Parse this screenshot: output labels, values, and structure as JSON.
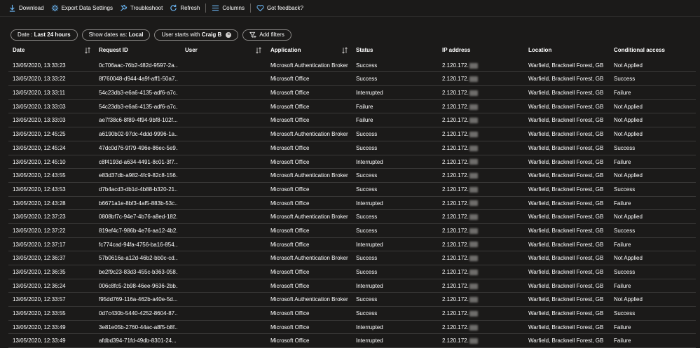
{
  "toolbar": {
    "download": "Download",
    "export": "Export Data Settings",
    "troubleshoot": "Troubleshoot",
    "refresh": "Refresh",
    "columns": "Columns",
    "feedback": "Got feedback?"
  },
  "filters": {
    "date_label": "Date : ",
    "date_value": "Last 24 hours",
    "showdates_label": "Show dates as: ",
    "showdates_value": "Local",
    "user_label": "User starts with ",
    "user_value": "Craig B",
    "add_filters": "Add filters"
  },
  "columns": {
    "date": "Date",
    "request_id": "Request ID",
    "user": "User",
    "application": "Application",
    "status": "Status",
    "ip_address": "IP address",
    "location": "Location",
    "conditional_access": "Conditional access"
  },
  "rows": [
    {
      "date": "13/05/2020, 13:33:23",
      "request_id": "0c706aac-76b2-482d-9597-2a...",
      "application": "Microsoft Authentication Broker",
      "status": "Success",
      "ip": "2.120.172.",
      "location": "Warfield, Bracknell Forest, GB",
      "ca": "Not Applied"
    },
    {
      "date": "13/05/2020, 13:33:22",
      "request_id": "8f760048-d944-4a9f-aff1-50a7...",
      "application": "Microsoft Office",
      "status": "Success",
      "ip": "2.120.172.",
      "location": "Warfield, Bracknell Forest, GB",
      "ca": "Success"
    },
    {
      "date": "13/05/2020, 13:33:11",
      "request_id": "54c23db3-e6a6-4135-adf6-a7c...",
      "application": "Microsoft Office",
      "status": "Interrupted",
      "ip": "2.120.172.",
      "location": "Warfield, Bracknell Forest, GB",
      "ca": "Failure"
    },
    {
      "date": "13/05/2020, 13:33:03",
      "request_id": "54c23db3-e6a6-4135-adf6-a7c...",
      "application": "Microsoft Office",
      "status": "Failure",
      "ip": "2.120.172.",
      "location": "Warfield, Bracknell Forest, GB",
      "ca": "Not Applied"
    },
    {
      "date": "13/05/2020, 13:33:03",
      "request_id": "ae7f38c6-8f89-4f94-9bf8-102f...",
      "application": "Microsoft Office",
      "status": "Failure",
      "ip": "2.120.172.",
      "location": "Warfield, Bracknell Forest, GB",
      "ca": "Not Applied"
    },
    {
      "date": "13/05/2020, 12:45:25",
      "request_id": "a6190b02-97dc-4ddd-9996-1a...",
      "application": "Microsoft Authentication Broker",
      "status": "Success",
      "ip": "2.120.172.",
      "location": "Warfield, Bracknell Forest, GB",
      "ca": "Not Applied"
    },
    {
      "date": "13/05/2020, 12:45:24",
      "request_id": "47dc0d76-9f79-496e-86ec-5e9...",
      "application": "Microsoft Office",
      "status": "Success",
      "ip": "2.120.172.",
      "location": "Warfield, Bracknell Forest, GB",
      "ca": "Success"
    },
    {
      "date": "13/05/2020, 12:45:10",
      "request_id": "c8f4193d-a634-4491-8c01-3f7...",
      "application": "Microsoft Office",
      "status": "Interrupted",
      "ip": "2.120.172.",
      "location": "Warfield, Bracknell Forest, GB",
      "ca": "Failure"
    },
    {
      "date": "13/05/2020, 12:43:55",
      "request_id": "e83d37db-a982-4fc9-82c8-156...",
      "application": "Microsoft Authentication Broker",
      "status": "Success",
      "ip": "2.120.172.",
      "location": "Warfield, Bracknell Forest, GB",
      "ca": "Not Applied"
    },
    {
      "date": "13/05/2020, 12:43:53",
      "request_id": "d7b4acd3-db1d-4b88-b320-21...",
      "application": "Microsoft Office",
      "status": "Success",
      "ip": "2.120.172.",
      "location": "Warfield, Bracknell Forest, GB",
      "ca": "Success"
    },
    {
      "date": "13/05/2020, 12:43:28",
      "request_id": "b6671a1e-8bf3-4af5-883b-53c...",
      "application": "Microsoft Office",
      "status": "Interrupted",
      "ip": "2.120.172.",
      "location": "Warfield, Bracknell Forest, GB",
      "ca": "Failure"
    },
    {
      "date": "13/05/2020, 12:37:23",
      "request_id": "0808bf7c-94e7-4b76-a8ed-182...",
      "application": "Microsoft Authentication Broker",
      "status": "Success",
      "ip": "2.120.172.",
      "location": "Warfield, Bracknell Forest, GB",
      "ca": "Not Applied"
    },
    {
      "date": "13/05/2020, 12:37:22",
      "request_id": "819ef4c7-986b-4e76-aa12-4b2...",
      "application": "Microsoft Office",
      "status": "Success",
      "ip": "2.120.172.",
      "location": "Warfield, Bracknell Forest, GB",
      "ca": "Success"
    },
    {
      "date": "13/05/2020, 12:37:17",
      "request_id": "fc774cad-94fa-4756-ba16-854...",
      "application": "Microsoft Office",
      "status": "Interrupted",
      "ip": "2.120.172.",
      "location": "Warfield, Bracknell Forest, GB",
      "ca": "Failure"
    },
    {
      "date": "13/05/2020, 12:36:37",
      "request_id": "57b0616a-a12d-46b2-bb0c-cd...",
      "application": "Microsoft Authentication Broker",
      "status": "Success",
      "ip": "2.120.172.",
      "location": "Warfield, Bracknell Forest, GB",
      "ca": "Not Applied"
    },
    {
      "date": "13/05/2020, 12:36:35",
      "request_id": "be2f9c23-83d3-455c-b363-058...",
      "application": "Microsoft Office",
      "status": "Success",
      "ip": "2.120.172.",
      "location": "Warfield, Bracknell Forest, GB",
      "ca": "Success"
    },
    {
      "date": "13/05/2020, 12:36:24",
      "request_id": "006c8fc5-2b98-46ee-9636-2bb...",
      "application": "Microsoft Office",
      "status": "Interrupted",
      "ip": "2.120.172.",
      "location": "Warfield, Bracknell Forest, GB",
      "ca": "Failure"
    },
    {
      "date": "13/05/2020, 12:33:57",
      "request_id": "f95dd769-116a-462b-a40e-5d...",
      "application": "Microsoft Authentication Broker",
      "status": "Success",
      "ip": "2.120.172.",
      "location": "Warfield, Bracknell Forest, GB",
      "ca": "Not Applied"
    },
    {
      "date": "13/05/2020, 12:33:55",
      "request_id": "0d7c430b-5440-4252-8604-87...",
      "application": "Microsoft Office",
      "status": "Success",
      "ip": "2.120.172.",
      "location": "Warfield, Bracknell Forest, GB",
      "ca": "Success"
    },
    {
      "date": "13/05/2020, 12:33:49",
      "request_id": "3e81e05b-2760-44ac-a8f5-b8f...",
      "application": "Microsoft Office",
      "status": "Interrupted",
      "ip": "2.120.172.",
      "location": "Warfield, Bracknell Forest, GB",
      "ca": "Failure"
    },
    {
      "date": "13/05/2020, 12:33:49",
      "request_id": "afdbd394-71fd-49db-8301-24...",
      "application": "Microsoft Office",
      "status": "Interrupted",
      "ip": "2.120.172.",
      "location": "Warfield, Bracknell Forest, GB",
      "ca": "Failure"
    }
  ]
}
